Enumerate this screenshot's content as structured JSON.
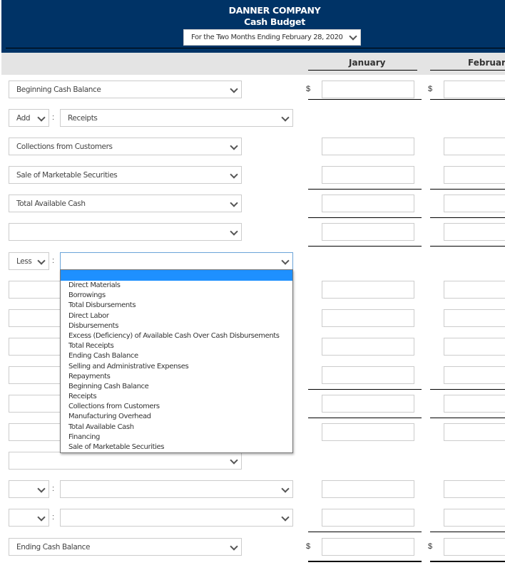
{
  "header": {
    "company": "DANNER COMPANY",
    "title": "Cash Budget",
    "period": "For the Two Months Ending February 28, 2020"
  },
  "columns": [
    "January",
    "February"
  ],
  "currency_symbol": "$",
  "rows": [
    {
      "type": "label",
      "value": "Beginning Cash Balance"
    },
    {
      "type": "operator",
      "operator": "Add",
      "value": "Receipts"
    },
    {
      "type": "label",
      "value": "Collections from Customers"
    },
    {
      "type": "label",
      "value": "Sale of Marketable Securities"
    },
    {
      "type": "label",
      "value": "Total Available Cash"
    },
    {
      "type": "label",
      "value": ""
    },
    {
      "type": "operator",
      "operator": "Less",
      "value": ""
    },
    {
      "type": "label",
      "value": ""
    },
    {
      "type": "label",
      "value": ""
    },
    {
      "type": "label",
      "value": ""
    },
    {
      "type": "label",
      "value": ""
    },
    {
      "type": "label",
      "value": ""
    },
    {
      "type": "label",
      "value": ""
    },
    {
      "type": "label",
      "value": ""
    },
    {
      "type": "operator",
      "operator": "",
      "value": ""
    },
    {
      "type": "operator",
      "operator": "",
      "value": ""
    },
    {
      "type": "label",
      "value": "Ending Cash Balance"
    }
  ],
  "dropdown": {
    "highlighted": "",
    "options": [
      "Direct Materials",
      "Borrowings",
      "Total Disbursements",
      "Direct Labor",
      "Disbursements",
      "Excess (Deficiency) of Available Cash Over Cash Disbursements",
      "Total Receipts",
      "Ending Cash Balance",
      "Selling and Administrative Expenses",
      "Repayments",
      "Beginning Cash Balance",
      "Receipts",
      "Collections from Customers",
      "Manufacturing Overhead",
      "Total Available Cash",
      "Financing",
      "Sale of Marketable Securities"
    ]
  },
  "colors": {
    "header_bg": "#003366",
    "column_header_bg": "#e4e4e4",
    "dropdown_highlight": "#1e90ff"
  }
}
